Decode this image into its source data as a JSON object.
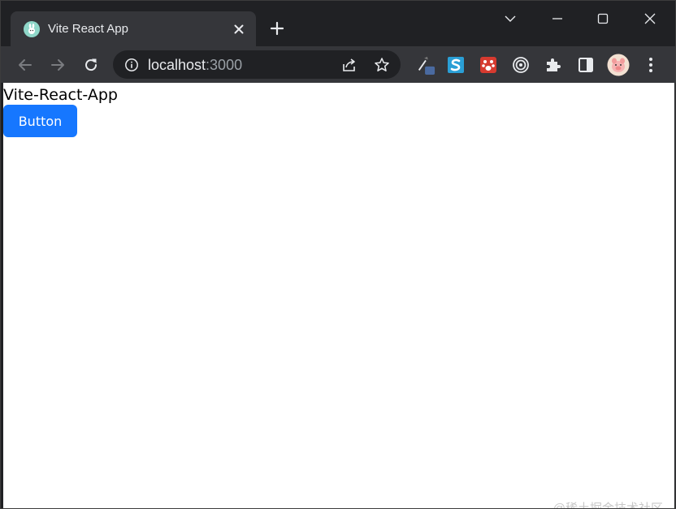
{
  "browser": {
    "tab": {
      "title": "Vite React App",
      "favicon": "vite-bunny-icon"
    },
    "new_tab_label": "+",
    "window_controls": [
      "tab-search-icon",
      "minimize-icon",
      "maximize-icon",
      "close-icon"
    ],
    "address_bar": {
      "host": "localhost",
      "port": ":3000"
    },
    "extensions": [
      "eyedropper-extension-icon",
      "s-extension-icon",
      "paw-extension-icon",
      "target-extension-icon",
      "puzzle-extensions-icon",
      "side-panel-icon"
    ],
    "profile": "avatar"
  },
  "page": {
    "title": "Vite-React-App",
    "button_label": "Button",
    "watermark": "@稀土掘金技术社区"
  },
  "colors": {
    "chrome_dark": "#202124",
    "chrome_toolbar": "#35363a",
    "button_primary": "#1677ff",
    "page_bg": "#ffffff"
  }
}
